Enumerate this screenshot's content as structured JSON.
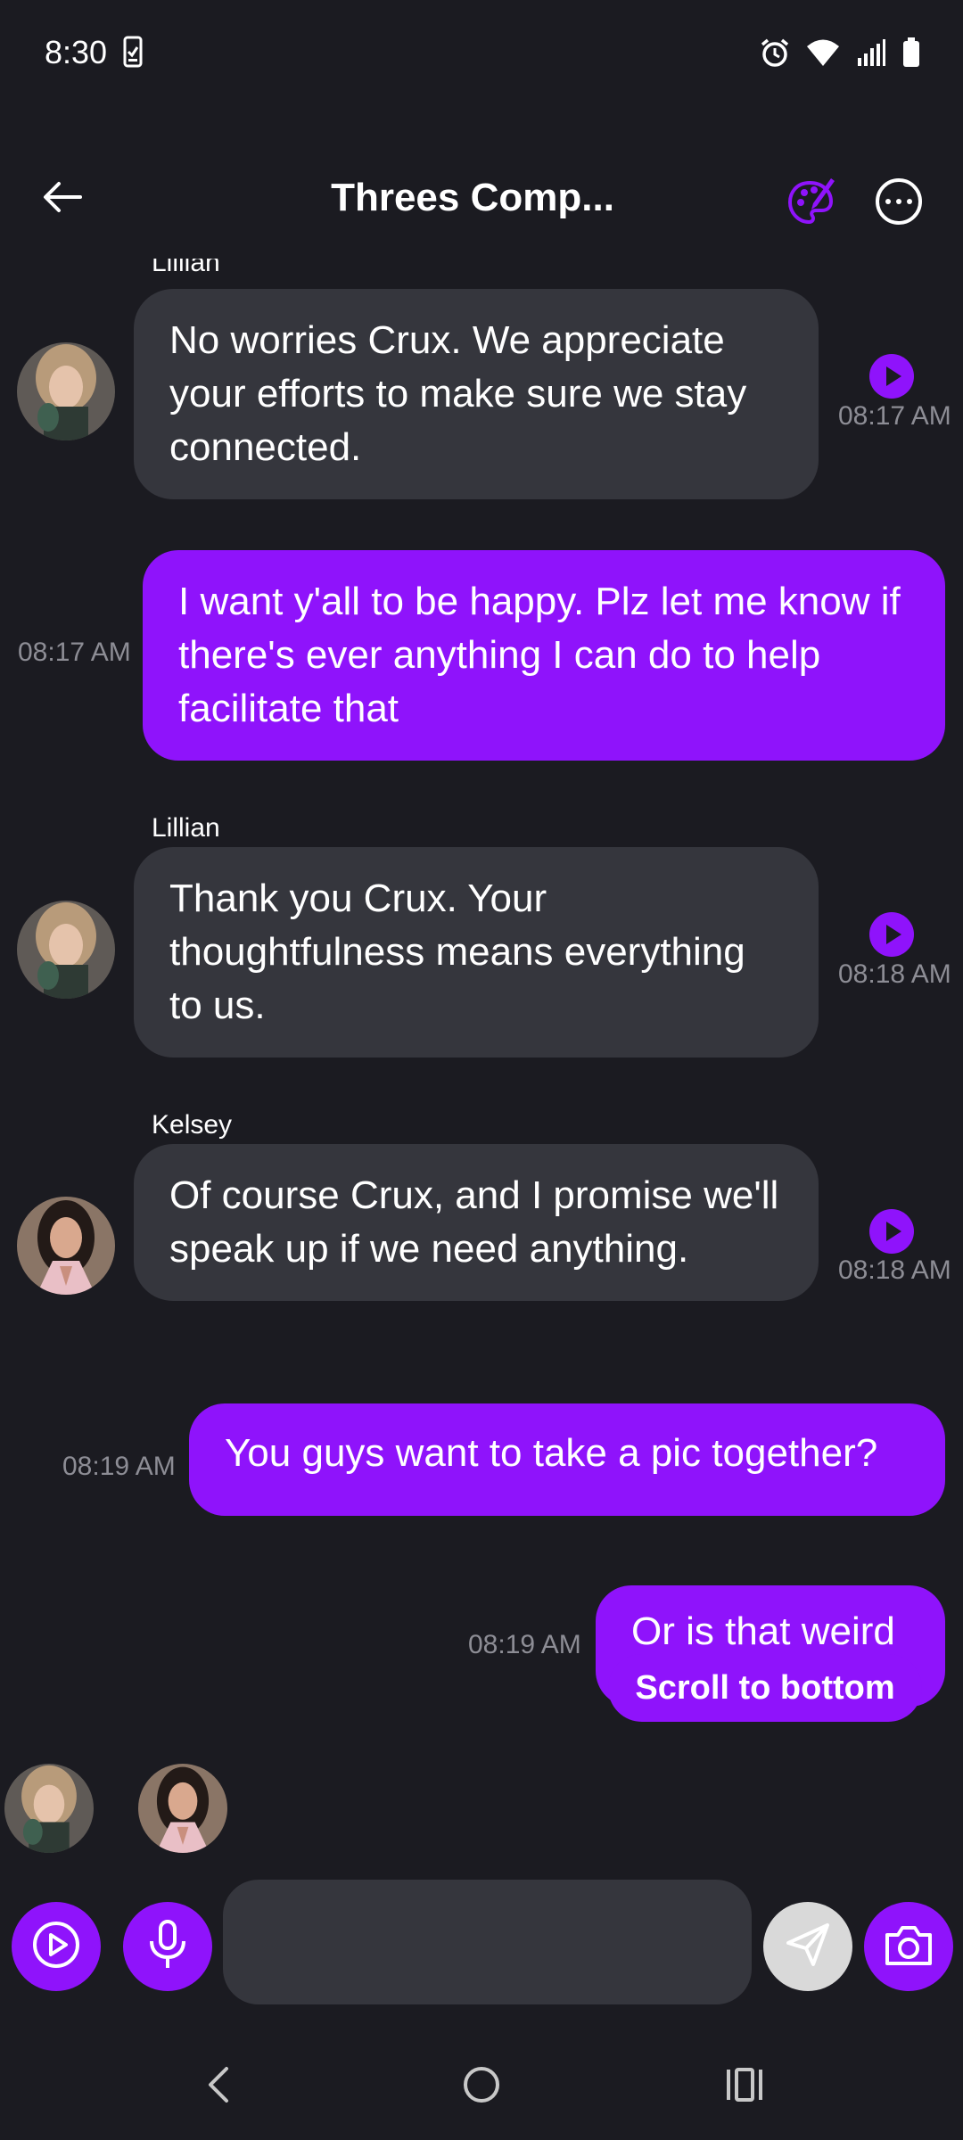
{
  "status_bar": {
    "time": "8:30"
  },
  "header": {
    "title": "Threes Comp..."
  },
  "messages": [
    {
      "direction": "incoming",
      "sender": "Lillian",
      "text": "No worries Crux. We appreciate your efforts to make sure we stay connected.",
      "time": "08:17 AM"
    },
    {
      "direction": "outgoing",
      "text": "I want y'all to be happy. Plz let me know if there's ever anything I can do to help facilitate that",
      "time": "08:17 AM"
    },
    {
      "direction": "incoming",
      "sender": "Lillian",
      "text": "Thank you Crux. Your thoughtfulness means everything to us.",
      "time": "08:18 AM"
    },
    {
      "direction": "incoming",
      "sender": "Kelsey",
      "text": "Of course Crux, and I promise we'll speak up if we need anything.",
      "time": "08:18 AM"
    },
    {
      "direction": "outgoing",
      "text": "You guys want to take a pic together?",
      "time": "08:19 AM"
    },
    {
      "direction": "outgoing",
      "text": "Or is that weird",
      "time": "08:19 AM"
    }
  ],
  "scroll_to_bottom_label": "Scroll to bottom",
  "colors": {
    "background": "#1b1b21",
    "accent": "#8f13fb",
    "incoming_bubble": "#35363d",
    "timestamp": "#8d8d95"
  }
}
